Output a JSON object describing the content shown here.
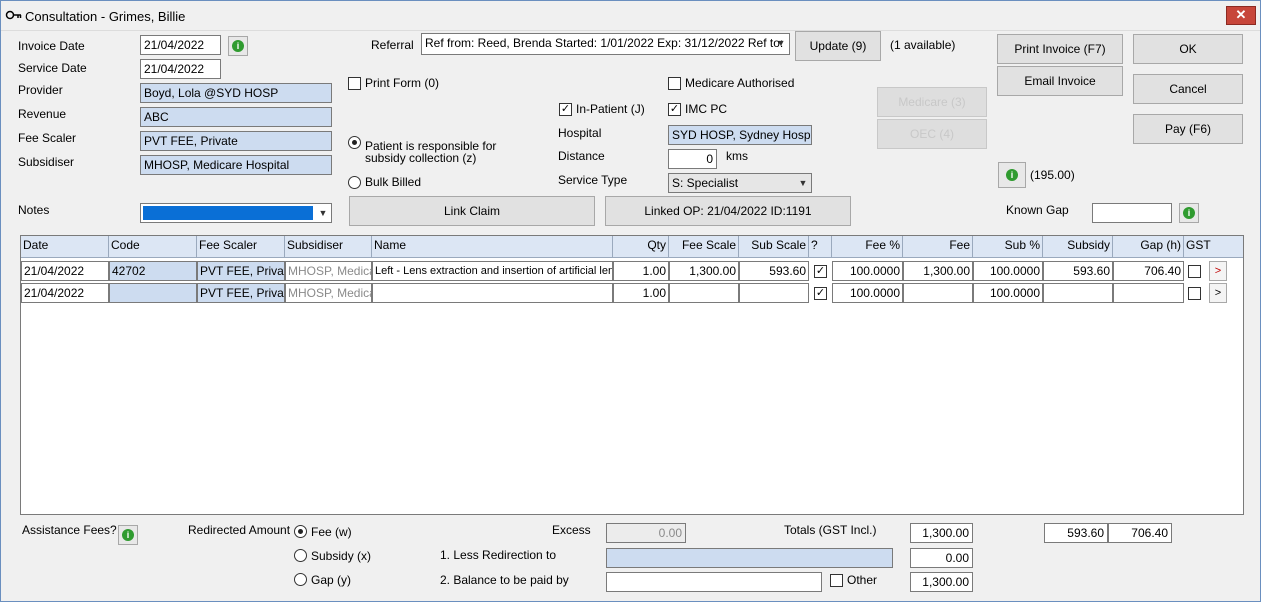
{
  "window": {
    "title": "Consultation - Grimes, Billie",
    "close_label": "✕"
  },
  "left": {
    "invoice_date_label": "Invoice Date",
    "invoice_date": "21/04/2022",
    "service_date_label": "Service Date",
    "service_date": "21/04/2022",
    "provider_label": "Provider",
    "provider": "Boyd, Lola @SYD HOSP",
    "revenue_label": "Revenue",
    "revenue": "ABC",
    "fee_scaler_label": "Fee Scaler",
    "fee_scaler": "PVT FEE, Private",
    "subsidiser_label": "Subsidiser",
    "subsidiser": "MHOSP, Medicare Hospital",
    "notes_label": "Notes"
  },
  "middle": {
    "referral_label": "Referral",
    "referral_value": "Ref from: Reed, Brenda Started: 1/01/2022 Exp: 31/12/2022 Ref to:",
    "update_button": "Update (9)",
    "available_text": "(1 available)",
    "print_form_label": "Print Form (0)",
    "medicare_authorised_label": "Medicare Authorised",
    "in_patient_label": "In-Patient (J)",
    "imc_pc_label": "IMC PC",
    "patient_responsible_label": "Patient is responsible for subsidy collection (z)",
    "bulk_billed_label": "Bulk Billed",
    "hospital_label": "Hospital",
    "hospital_value": "SYD HOSP, Sydney Hospital",
    "distance_label": "Distance",
    "distance_value": "0",
    "distance_unit": "kms",
    "service_type_label": "Service Type",
    "service_type_value": "S: Specialist",
    "link_claim_button": "Link Claim",
    "linked_op_button": "Linked OP: 21/04/2022 ID:1191"
  },
  "right": {
    "medicare_button": "Medicare (3)",
    "oec_button": "OEC (4)",
    "print_invoice_button": "Print Invoice (F7)",
    "email_invoice_button": "Email Invoice",
    "ok_button": "OK",
    "cancel_button": "Cancel",
    "pay_button": "Pay (F6)",
    "amount_text": "(195.00)",
    "known_gap_label": "Known Gap",
    "known_gap_value": ""
  },
  "grid": {
    "headers": [
      "Date",
      "Code",
      "Fee Scaler",
      "Subsidiser",
      "Name",
      "Qty",
      "Fee Scale",
      "Sub Scale",
      "?",
      "Fee %",
      "Fee",
      "Sub %",
      "Subsidy",
      "Gap (h)",
      "GST"
    ],
    "rows": [
      {
        "date": "21/04/2022",
        "code": "42702",
        "fee_scaler": "PVT FEE, Private",
        "subsidiser": "MHOSP, Medicare Hospital",
        "name": "Left - Lens extraction and insertion of artificial lens",
        "qty": "1.00",
        "fee_scale": "1,300.00",
        "sub_scale": "593.60",
        "q": "✓",
        "fee_pct": "100.0000",
        "fee": "1,300.00",
        "sub_pct": "100.0000",
        "subsidy": "593.60",
        "gap": "706.40",
        "gst": "",
        "action": ">"
      },
      {
        "date": "21/04/2022",
        "code": "",
        "fee_scaler": "PVT FEE, Private",
        "subsidiser": "MHOSP, Medicare Hospital",
        "name": "",
        "qty": "1.00",
        "fee_scale": "",
        "sub_scale": "",
        "q": "✓",
        "fee_pct": "100.0000",
        "fee": "",
        "sub_pct": "100.0000",
        "subsidy": "",
        "gap": "",
        "gst": "",
        "action": ">"
      }
    ]
  },
  "footer": {
    "assistance_fees_label": "Assistance Fees?",
    "redirected_amount_label": "Redirected Amount",
    "fee_option": "Fee (w)",
    "subsidy_option": "Subsidy (x)",
    "gap_option": "Gap (y)",
    "excess_label": "Excess",
    "excess_value": "0.00",
    "totals_label": "Totals (GST Incl.)",
    "total_fee": "1,300.00",
    "total_subsidy": "593.60",
    "total_gap": "706.40",
    "less_redirection_label": "1. Less Redirection to",
    "less_redirection_value": "0.00",
    "balance_label": "2. Balance to be paid by",
    "balance_value": "1,300.00",
    "other_label": "Other"
  }
}
